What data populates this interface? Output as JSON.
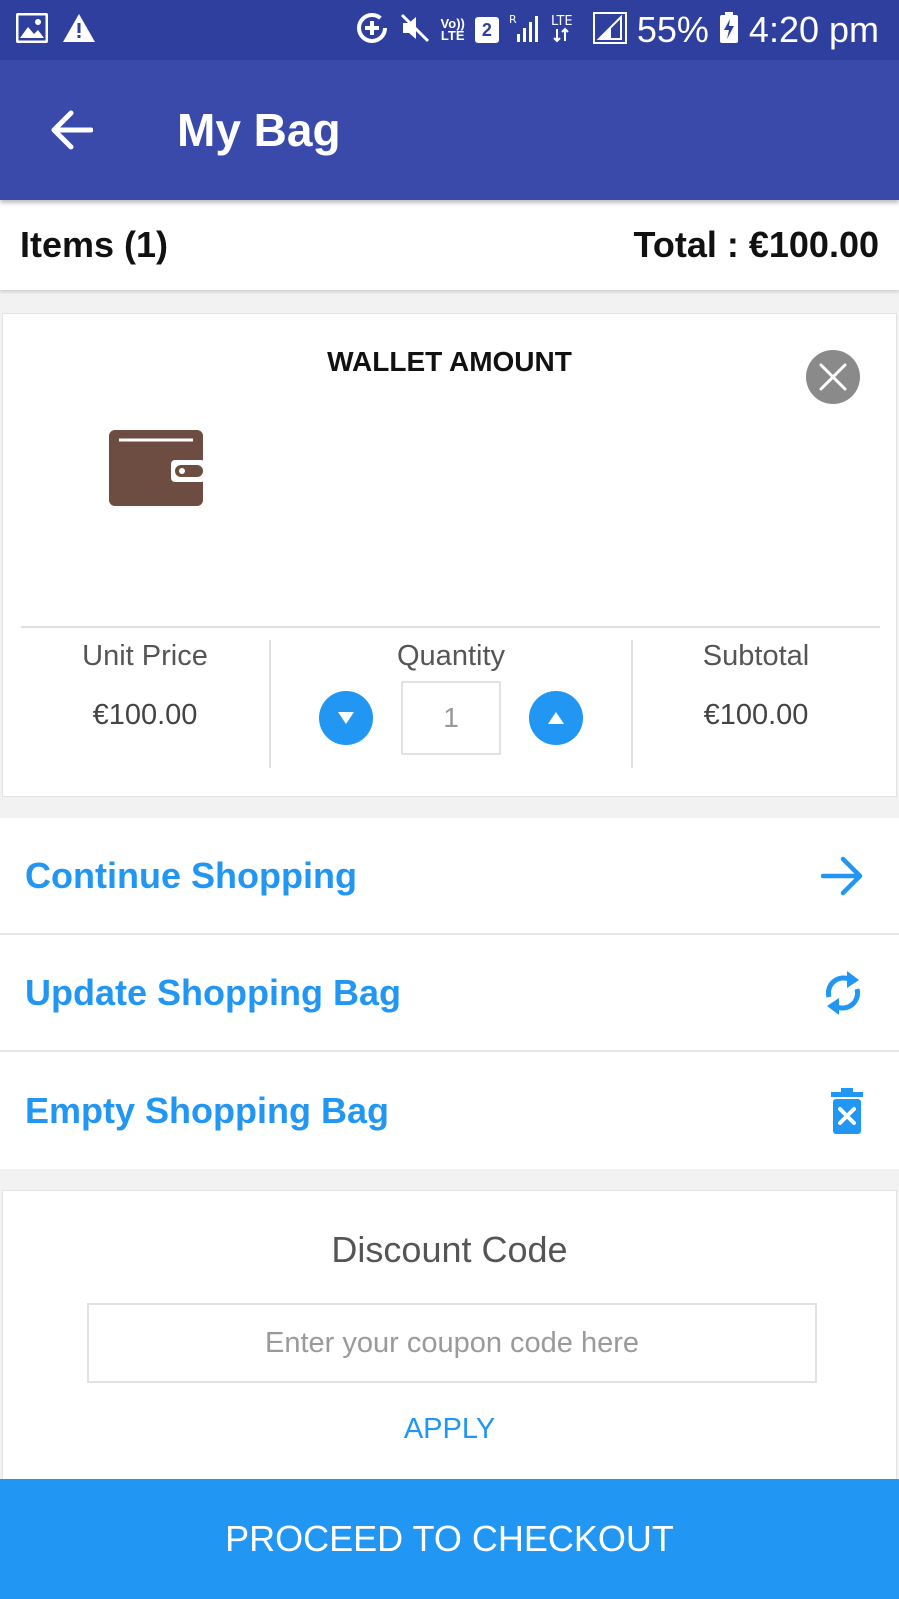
{
  "status_bar": {
    "battery": "55%",
    "time": "4:20 pm",
    "volte": "Vo))\nLTE",
    "sim_number": "2",
    "lte_label": "LTE"
  },
  "toolbar": {
    "title": "My Bag"
  },
  "summary": {
    "items_label": "Items (1)",
    "total_label": "Total : €100.00"
  },
  "product": {
    "name": "WALLET AMOUNT",
    "unit_price_label": "Unit Price",
    "unit_price": "€100.00",
    "quantity_label": "Quantity",
    "quantity": "1",
    "subtotal_label": "Subtotal",
    "subtotal": "€100.00"
  },
  "actions": [
    {
      "label": "Continue Shopping",
      "icon": "arrow-right-icon"
    },
    {
      "label": "Update Shopping Bag",
      "icon": "refresh-icon"
    },
    {
      "label": "Empty Shopping Bag",
      "icon": "trash-icon"
    }
  ],
  "discount": {
    "title": "Discount Code",
    "placeholder": "Enter your coupon code here",
    "value": "",
    "apply_label": "APPLY"
  },
  "checkout": {
    "label": "PROCEED TO CHECKOUT"
  },
  "colors": {
    "status_bar": "#2f3f9e",
    "toolbar": "#3a4aab",
    "accent": "#2196f3",
    "wallet_brown": "#6d4c41"
  }
}
